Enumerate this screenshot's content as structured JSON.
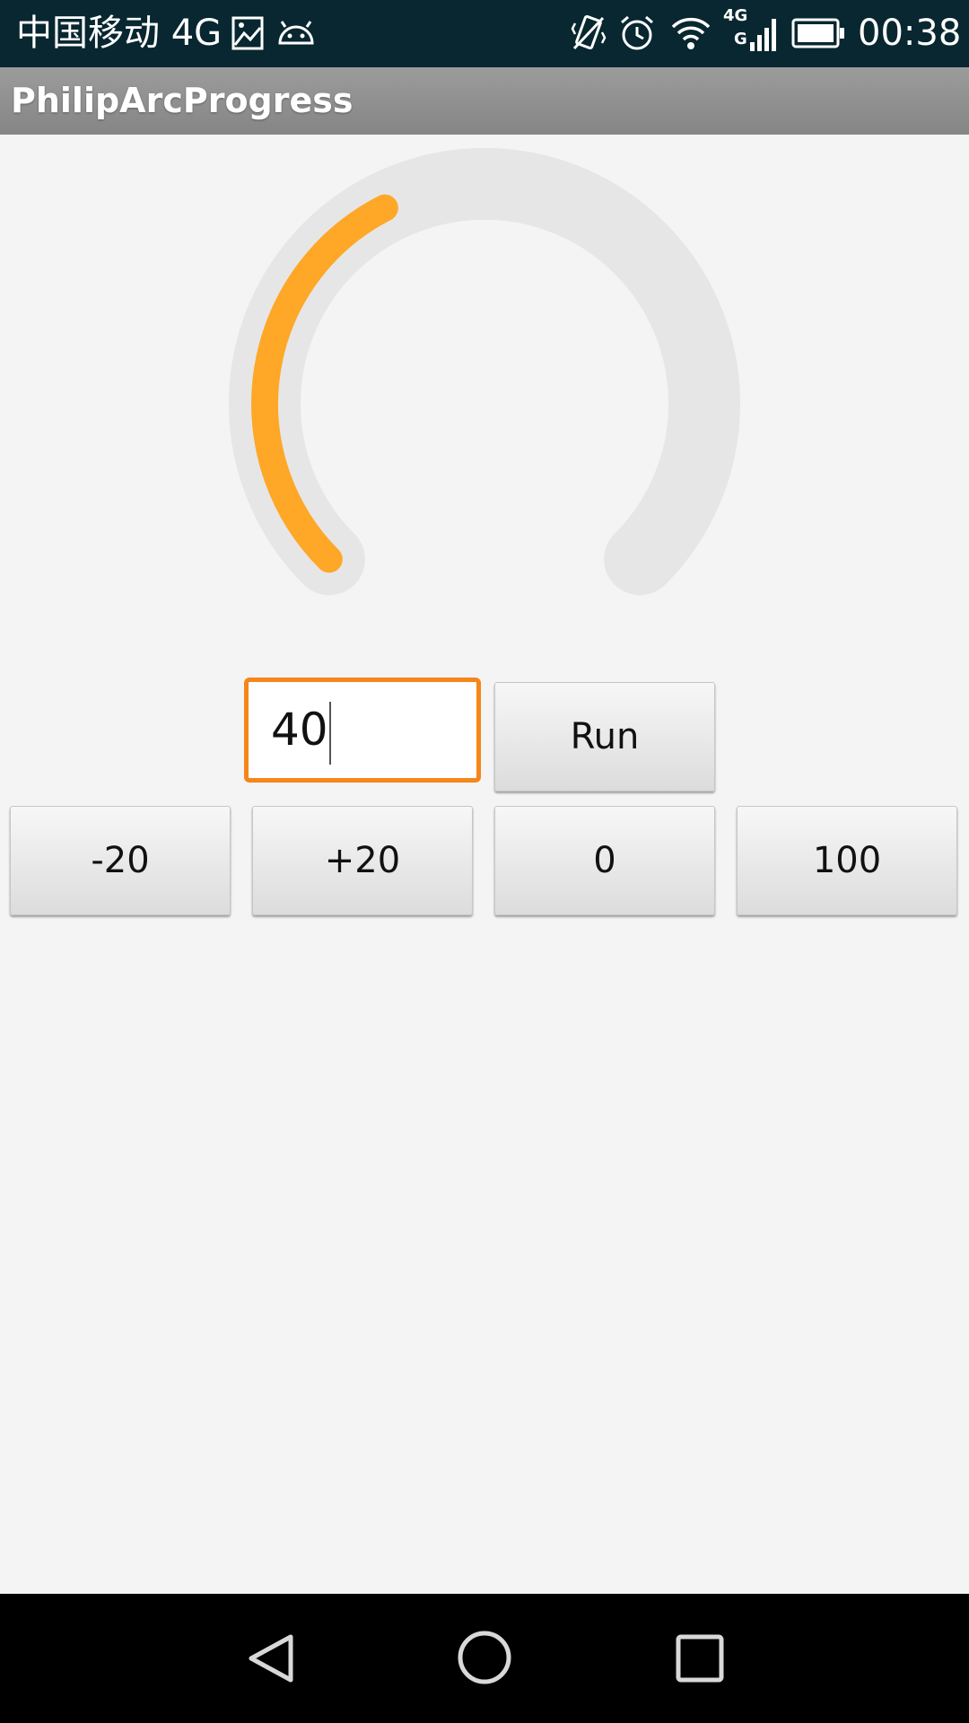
{
  "status_bar": {
    "carrier": "中国移动 4G",
    "network_badge_top": "4G",
    "network_badge_bottom": "G",
    "time": "00:38",
    "icons": [
      "gallery-icon",
      "android-icon",
      "vibrate-icon",
      "alarm-icon",
      "wifi-icon",
      "signal-icon",
      "battery-icon"
    ]
  },
  "app_bar": {
    "title": "PhilipArcProgress"
  },
  "arc_progress": {
    "value": 40,
    "max": 100,
    "progress_color": "#ffa726",
    "track_color": "#e6e6e6"
  },
  "input": {
    "value": "40"
  },
  "buttons": {
    "run": "Run",
    "minus20": "-20",
    "plus20": "+20",
    "zero": "0",
    "hundred": "100"
  },
  "colors": {
    "status_bar": "#082730",
    "accent": "#f5861a",
    "background": "#f4f4f4"
  },
  "nav_bar": {
    "icons": [
      "back-icon",
      "home-icon",
      "recents-icon"
    ]
  }
}
